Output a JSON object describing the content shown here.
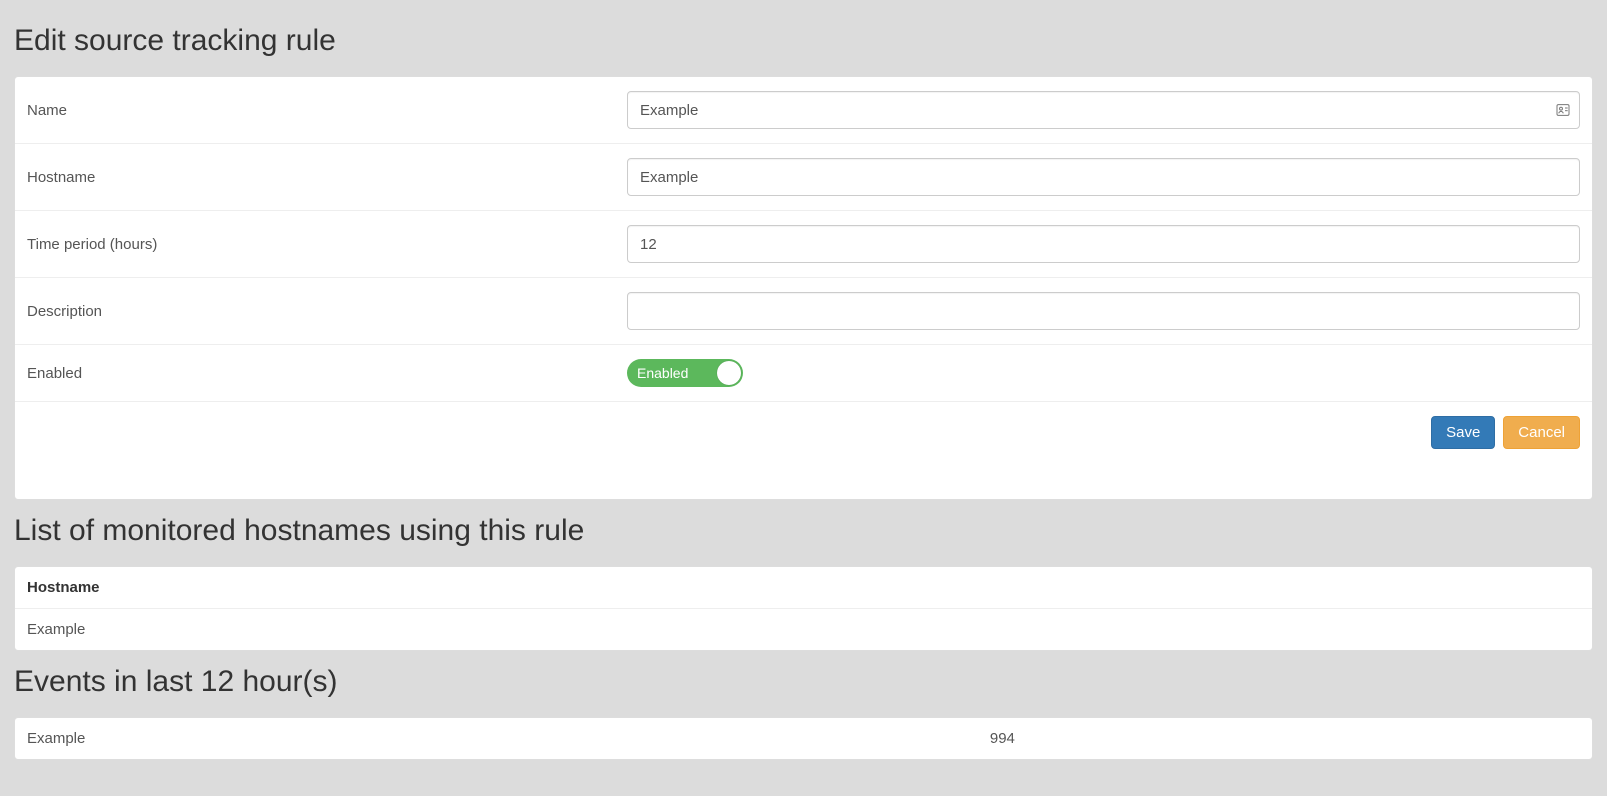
{
  "section_edit": {
    "title": "Edit source tracking rule",
    "fields": {
      "name": {
        "label": "Name",
        "value": "Example"
      },
      "hostname": {
        "label": "Hostname",
        "value": "Example"
      },
      "time_period": {
        "label": "Time period (hours)",
        "value": "12"
      },
      "description": {
        "label": "Description",
        "value": ""
      },
      "enabled": {
        "label": "Enabled",
        "toggle_text": "Enabled",
        "state": true
      }
    },
    "buttons": {
      "save": "Save",
      "cancel": "Cancel"
    }
  },
  "section_hostnames": {
    "title": "List of monitored hostnames using this rule",
    "header": "Hostname",
    "rows": [
      "Example"
    ]
  },
  "section_events": {
    "title": "Events in last 12 hour(s)",
    "rows": [
      {
        "hostname": "Example",
        "count": "994"
      }
    ]
  },
  "icons": {
    "contact_card": "contact-card-icon"
  },
  "colors": {
    "primary": "#337ab7",
    "warning": "#f0ad4e",
    "success": "#5cb85c",
    "page_bg": "#dcdcdc"
  }
}
